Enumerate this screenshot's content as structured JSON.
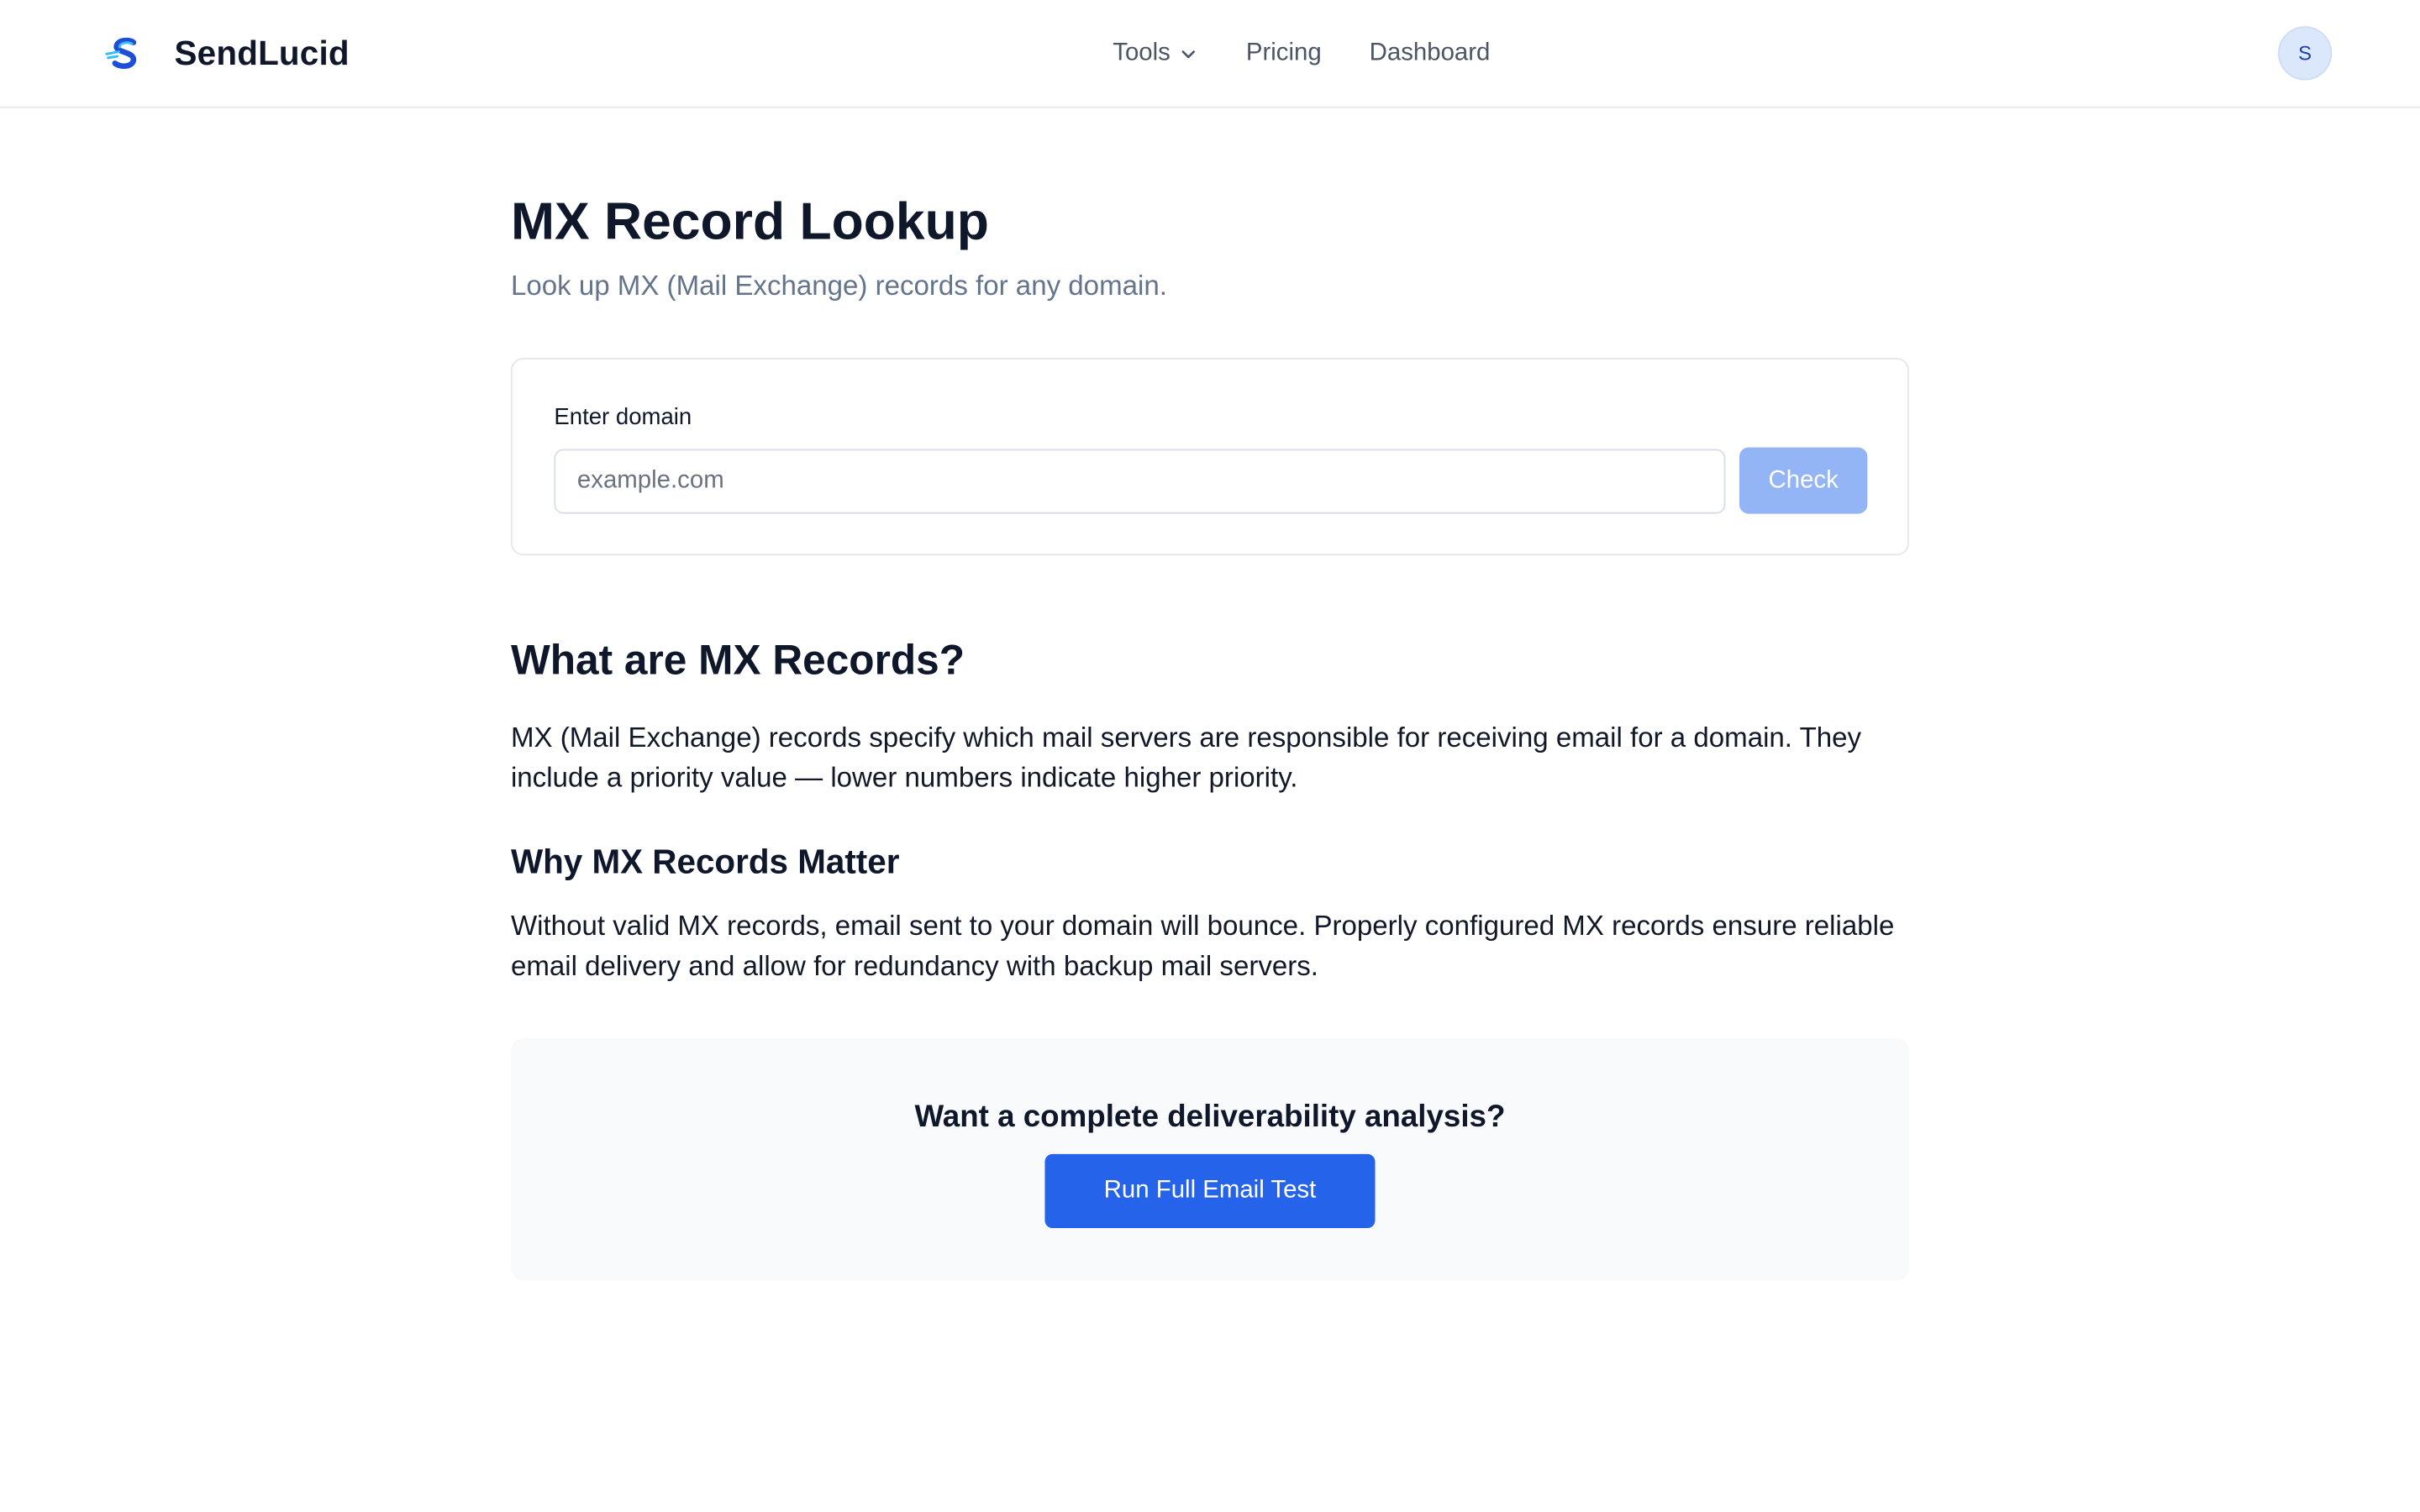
{
  "header": {
    "brand": {
      "name": "SendLucid",
      "logo_icon": "sendlucid-s-logo-icon"
    },
    "nav": [
      {
        "label": "Tools",
        "has_dropdown": true
      },
      {
        "label": "Pricing"
      },
      {
        "label": "Dashboard"
      }
    ],
    "avatar_initial": "S"
  },
  "page": {
    "title": "MX Record Lookup",
    "subtitle": "Look up MX (Mail Exchange) records for any domain."
  },
  "lookup": {
    "label": "Enter domain",
    "value": "",
    "placeholder": "example.com",
    "button_label": "Check"
  },
  "info": {
    "title": "What are MX Records?",
    "paragraph": "MX (Mail Exchange) records specify which mail servers are responsible for receiving email for a domain. They include a priority value — lower numbers indicate higher priority.",
    "subtitle": "Why MX Records Matter",
    "paragraph2": "Without valid MX records, email sent to your domain will bounce. Properly configured MX records ensure reliable email delivery and allow for redundancy with backup mail servers."
  },
  "cta": {
    "heading": "Want a complete deliverability analysis?",
    "button_label": "Run Full Email Test"
  },
  "colors": {
    "primary": "#2563eb",
    "primary_disabled": "#93b4f5",
    "text": "#0f172a",
    "muted": "#64748b",
    "border": "#e5e7eb",
    "cta_background": "#f8fafc",
    "avatar_background": "#dbe7fb"
  }
}
